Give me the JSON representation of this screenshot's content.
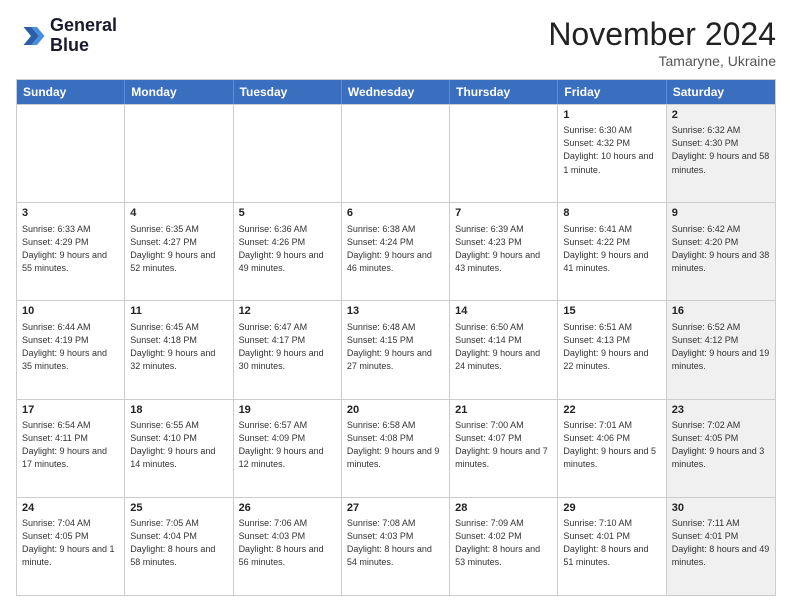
{
  "logo": {
    "line1": "General",
    "line2": "Blue"
  },
  "title": "November 2024",
  "subtitle": "Tamaryne, Ukraine",
  "headers": [
    "Sunday",
    "Monday",
    "Tuesday",
    "Wednesday",
    "Thursday",
    "Friday",
    "Saturday"
  ],
  "rows": [
    [
      {
        "day": "",
        "info": "",
        "shaded": false
      },
      {
        "day": "",
        "info": "",
        "shaded": false
      },
      {
        "day": "",
        "info": "",
        "shaded": false
      },
      {
        "day": "",
        "info": "",
        "shaded": false
      },
      {
        "day": "",
        "info": "",
        "shaded": false
      },
      {
        "day": "1",
        "info": "Sunrise: 6:30 AM\nSunset: 4:32 PM\nDaylight: 10 hours and 1 minute.",
        "shaded": false
      },
      {
        "day": "2",
        "info": "Sunrise: 6:32 AM\nSunset: 4:30 PM\nDaylight: 9 hours and 58 minutes.",
        "shaded": true
      }
    ],
    [
      {
        "day": "3",
        "info": "Sunrise: 6:33 AM\nSunset: 4:29 PM\nDaylight: 9 hours and 55 minutes.",
        "shaded": false
      },
      {
        "day": "4",
        "info": "Sunrise: 6:35 AM\nSunset: 4:27 PM\nDaylight: 9 hours and 52 minutes.",
        "shaded": false
      },
      {
        "day": "5",
        "info": "Sunrise: 6:36 AM\nSunset: 4:26 PM\nDaylight: 9 hours and 49 minutes.",
        "shaded": false
      },
      {
        "day": "6",
        "info": "Sunrise: 6:38 AM\nSunset: 4:24 PM\nDaylight: 9 hours and 46 minutes.",
        "shaded": false
      },
      {
        "day": "7",
        "info": "Sunrise: 6:39 AM\nSunset: 4:23 PM\nDaylight: 9 hours and 43 minutes.",
        "shaded": false
      },
      {
        "day": "8",
        "info": "Sunrise: 6:41 AM\nSunset: 4:22 PM\nDaylight: 9 hours and 41 minutes.",
        "shaded": false
      },
      {
        "day": "9",
        "info": "Sunrise: 6:42 AM\nSunset: 4:20 PM\nDaylight: 9 hours and 38 minutes.",
        "shaded": true
      }
    ],
    [
      {
        "day": "10",
        "info": "Sunrise: 6:44 AM\nSunset: 4:19 PM\nDaylight: 9 hours and 35 minutes.",
        "shaded": false
      },
      {
        "day": "11",
        "info": "Sunrise: 6:45 AM\nSunset: 4:18 PM\nDaylight: 9 hours and 32 minutes.",
        "shaded": false
      },
      {
        "day": "12",
        "info": "Sunrise: 6:47 AM\nSunset: 4:17 PM\nDaylight: 9 hours and 30 minutes.",
        "shaded": false
      },
      {
        "day": "13",
        "info": "Sunrise: 6:48 AM\nSunset: 4:15 PM\nDaylight: 9 hours and 27 minutes.",
        "shaded": false
      },
      {
        "day": "14",
        "info": "Sunrise: 6:50 AM\nSunset: 4:14 PM\nDaylight: 9 hours and 24 minutes.",
        "shaded": false
      },
      {
        "day": "15",
        "info": "Sunrise: 6:51 AM\nSunset: 4:13 PM\nDaylight: 9 hours and 22 minutes.",
        "shaded": false
      },
      {
        "day": "16",
        "info": "Sunrise: 6:52 AM\nSunset: 4:12 PM\nDaylight: 9 hours and 19 minutes.",
        "shaded": true
      }
    ],
    [
      {
        "day": "17",
        "info": "Sunrise: 6:54 AM\nSunset: 4:11 PM\nDaylight: 9 hours and 17 minutes.",
        "shaded": false
      },
      {
        "day": "18",
        "info": "Sunrise: 6:55 AM\nSunset: 4:10 PM\nDaylight: 9 hours and 14 minutes.",
        "shaded": false
      },
      {
        "day": "19",
        "info": "Sunrise: 6:57 AM\nSunset: 4:09 PM\nDaylight: 9 hours and 12 minutes.",
        "shaded": false
      },
      {
        "day": "20",
        "info": "Sunrise: 6:58 AM\nSunset: 4:08 PM\nDaylight: 9 hours and 9 minutes.",
        "shaded": false
      },
      {
        "day": "21",
        "info": "Sunrise: 7:00 AM\nSunset: 4:07 PM\nDaylight: 9 hours and 7 minutes.",
        "shaded": false
      },
      {
        "day": "22",
        "info": "Sunrise: 7:01 AM\nSunset: 4:06 PM\nDaylight: 9 hours and 5 minutes.",
        "shaded": false
      },
      {
        "day": "23",
        "info": "Sunrise: 7:02 AM\nSunset: 4:05 PM\nDaylight: 9 hours and 3 minutes.",
        "shaded": true
      }
    ],
    [
      {
        "day": "24",
        "info": "Sunrise: 7:04 AM\nSunset: 4:05 PM\nDaylight: 9 hours and 1 minute.",
        "shaded": false
      },
      {
        "day": "25",
        "info": "Sunrise: 7:05 AM\nSunset: 4:04 PM\nDaylight: 8 hours and 58 minutes.",
        "shaded": false
      },
      {
        "day": "26",
        "info": "Sunrise: 7:06 AM\nSunset: 4:03 PM\nDaylight: 8 hours and 56 minutes.",
        "shaded": false
      },
      {
        "day": "27",
        "info": "Sunrise: 7:08 AM\nSunset: 4:03 PM\nDaylight: 8 hours and 54 minutes.",
        "shaded": false
      },
      {
        "day": "28",
        "info": "Sunrise: 7:09 AM\nSunset: 4:02 PM\nDaylight: 8 hours and 53 minutes.",
        "shaded": false
      },
      {
        "day": "29",
        "info": "Sunrise: 7:10 AM\nSunset: 4:01 PM\nDaylight: 8 hours and 51 minutes.",
        "shaded": false
      },
      {
        "day": "30",
        "info": "Sunrise: 7:11 AM\nSunset: 4:01 PM\nDaylight: 8 hours and 49 minutes.",
        "shaded": true
      }
    ]
  ]
}
